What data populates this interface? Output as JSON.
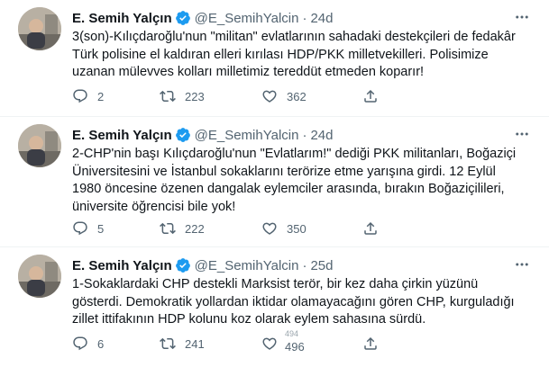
{
  "tweets": [
    {
      "name": "E. Semih Yalçın",
      "handle": "@E_SemihYalcin",
      "separator": "·",
      "time": "24d",
      "text": "3(son)-Kılıçdaroğlu'nun \"militan\" evlatlarının sahadaki destekçileri de fedakâr\nTürk polisine el kaldıran elleri kırılası HDP/PKK milletvekilleri. Polisimize\nuzanan mülevves kolları milletimiz tereddüt etmeden koparır!",
      "replies": "2",
      "retweets": "223",
      "likes": "362"
    },
    {
      "name": "E. Semih Yalçın",
      "handle": "@E_SemihYalcin",
      "separator": "·",
      "time": "24d",
      "text": "2-CHP'nin başı Kılıçdaroğlu'nun \"Evlatlarım!\" dediği PKK militanları, Boğaziçi\nÜniversitesini ve İstanbul sokaklarını terörize etme yarışına girdi. 12 Eylül\n1980 öncesine özenen dangalak eylemciler arasında, bırakın Boğaziçilileri,\nüniversite öğrencisi bile yok!",
      "replies": "5",
      "retweets": "222",
      "likes": "350"
    },
    {
      "name": "E. Semih Yalçın",
      "handle": "@E_SemihYalcin",
      "separator": "·",
      "time": "25d",
      "text": "1-Sokaklardaki CHP destekli Marksist terör, bir kez daha çirkin yüzünü\ngösterdi. Demokratik yollardan iktidar olamayacağını gören CHP, kurguladığı\nzillet ittifakının HDP kolunu koz olarak eylem sahasına sürdü.",
      "replies": "6",
      "retweets": "241",
      "likes_prev": "494",
      "likes": "496"
    }
  ],
  "colors": {
    "verified": "#1d9bf0",
    "text": "#0f1419",
    "secondary": "#536471",
    "divider": "#eff3f4"
  },
  "icons": {
    "reply": "reply-icon",
    "retweet": "retweet-icon",
    "like": "heart-icon",
    "share": "share-icon",
    "more": "more-icon",
    "verified": "verified-badge-icon"
  }
}
